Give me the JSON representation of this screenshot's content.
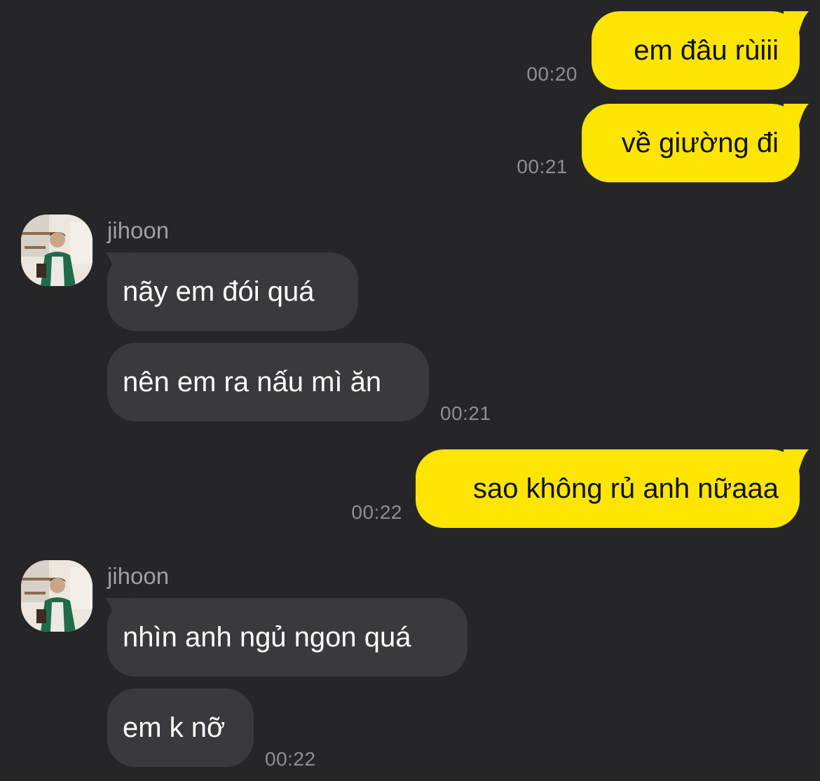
{
  "chat": {
    "messages": [
      {
        "direction": "out",
        "text": "em đâu rùiii",
        "time": "00:20"
      },
      {
        "direction": "out",
        "text": "về giường đi",
        "time": "00:21"
      },
      {
        "direction": "in",
        "sender": "jihoon",
        "text": "nãy em đói quá"
      },
      {
        "direction": "in",
        "text": "nên em ra nấu mì ăn",
        "time": "00:21"
      },
      {
        "direction": "out",
        "text": "sao không rủ anh nữaaa",
        "time": "00:22"
      },
      {
        "direction": "in",
        "sender": "jihoon",
        "text": "nhìn anh ngủ ngon quá"
      },
      {
        "direction": "in",
        "text": "em k nỡ",
        "time": "00:22"
      }
    ]
  },
  "colors": {
    "background": "#262628",
    "outgoing_bubble": "#fee500",
    "incoming_bubble": "#3a3a3d",
    "timestamp": "#8e8e93"
  },
  "icons": {
    "avatar": "avatar-photo"
  }
}
